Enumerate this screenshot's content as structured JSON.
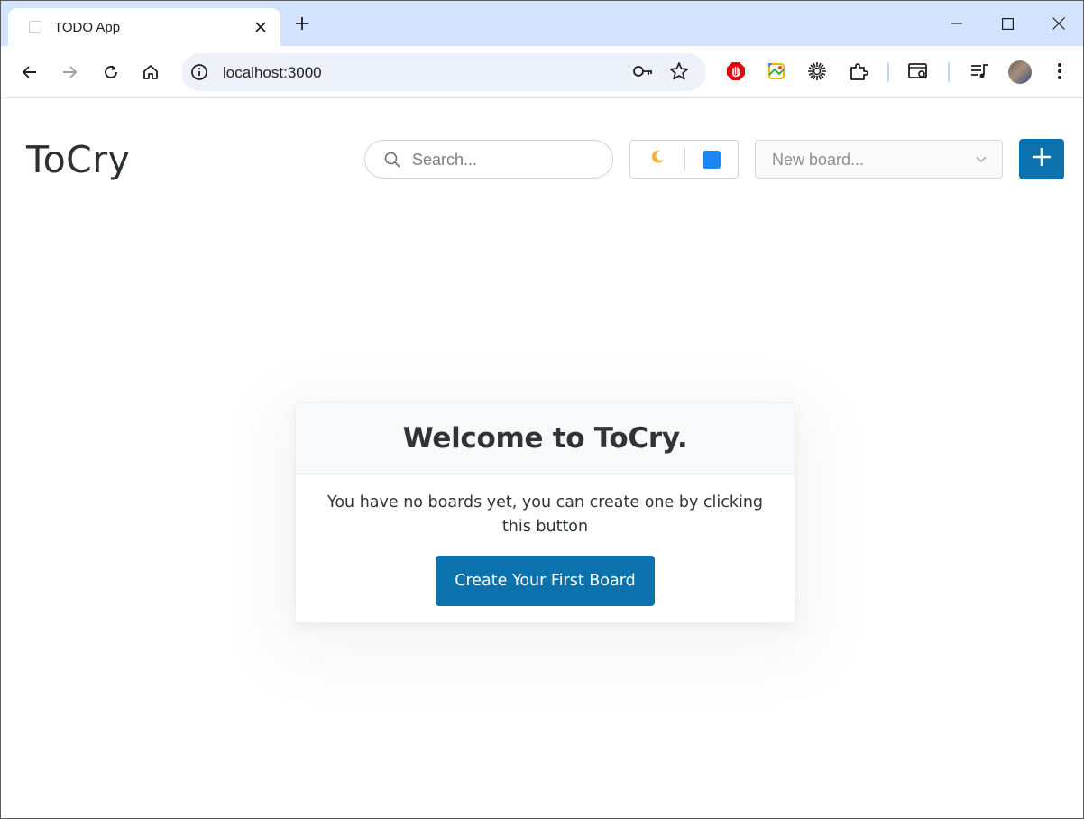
{
  "browser": {
    "tab_title": "TODO App",
    "url": "localhost:3000",
    "colors": {
      "tabstrip": "#d3e3fd",
      "omnibox": "#edf2fa"
    }
  },
  "app": {
    "brand": "ToCry",
    "search": {
      "placeholder": "Search..."
    },
    "theme_toggle": {
      "icon": "moon-icon",
      "color_swatch": "#1c86f2"
    },
    "board_select": {
      "placeholder": "New board..."
    },
    "add_button": {
      "icon": "plus-icon"
    },
    "accent": "#0b72ad"
  },
  "welcome": {
    "title": "Welcome to ToCry.",
    "text": "You have no boards yet, you can create one by clicking this button",
    "button_label": "Create Your First Board"
  }
}
